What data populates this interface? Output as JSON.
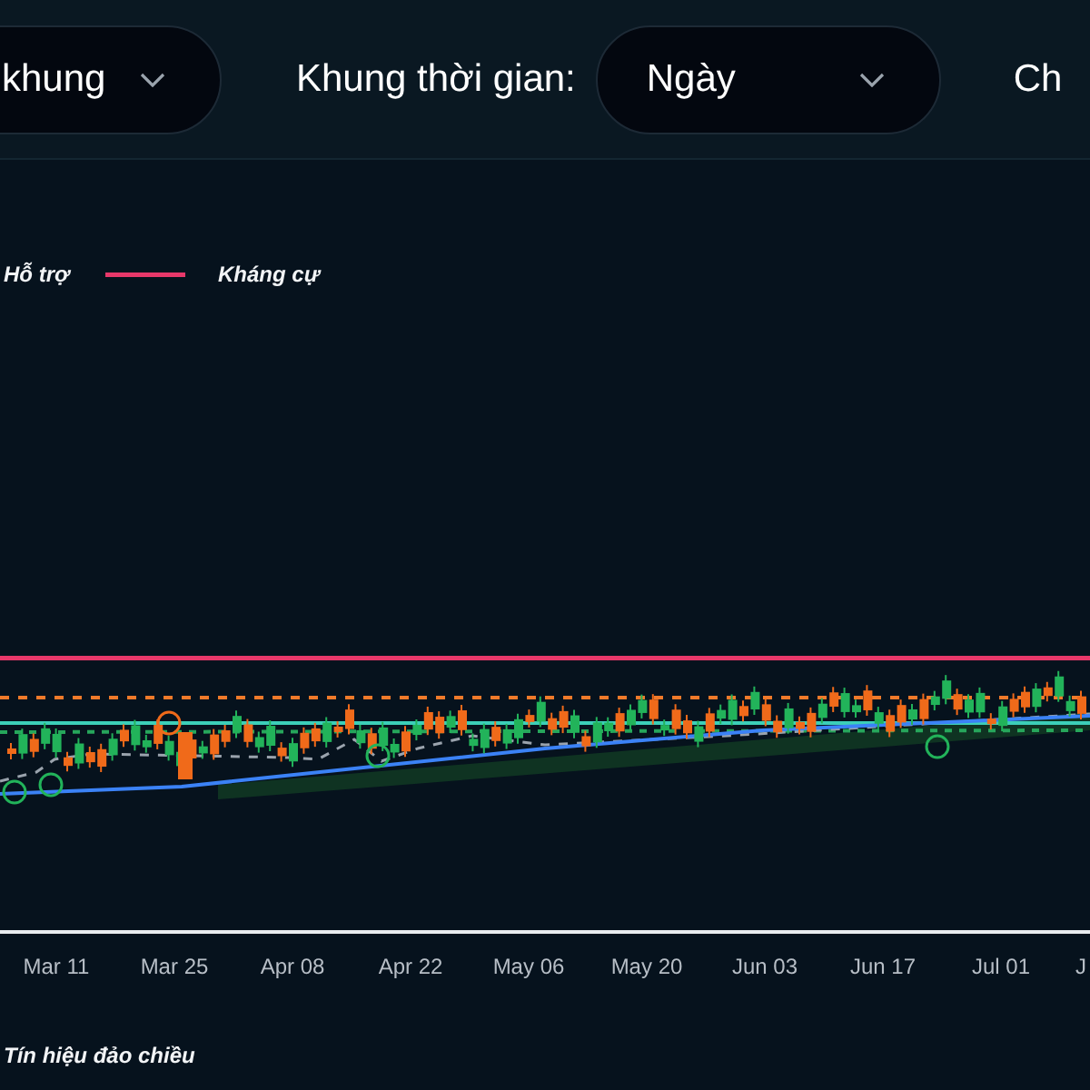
{
  "toolbar": {
    "filter_1": {
      "value": "khung"
    },
    "timeframe": {
      "label": "Khung thời gian:",
      "value": "Ngày"
    },
    "filter_3": {
      "label": "Ch"
    }
  },
  "chart": {
    "legend": [
      {
        "label": "Hỗ trợ",
        "kind": "text"
      },
      {
        "label": "Kháng cự",
        "kind": "line",
        "color": "#e8386a"
      }
    ],
    "x_axis_labels": [
      "Mar 11",
      "Mar 25",
      "Apr 08",
      "Apr 22",
      "May 06",
      "May 20",
      "Jun 03",
      "Jun 17",
      "Jul 01",
      "J"
    ],
    "footer_legend": [
      "Tín hiệu đảo chiều"
    ]
  }
}
